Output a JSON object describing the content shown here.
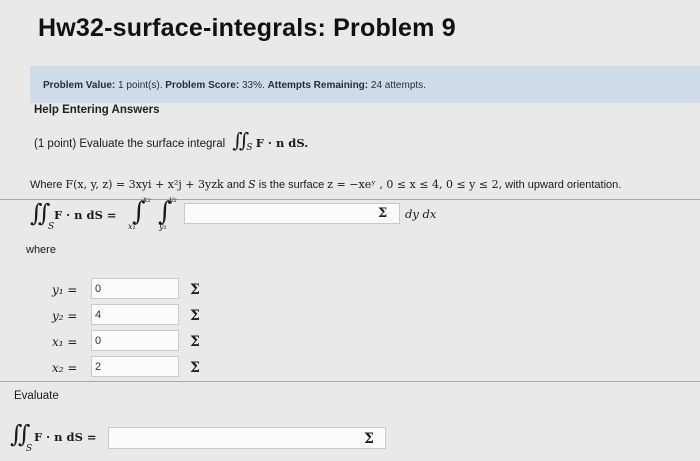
{
  "header": {
    "title": "Hw32-surface-integrals: Problem 9"
  },
  "status": {
    "value_label": "Problem Value:",
    "value_text": "1 point(s).",
    "score_label": "Problem Score:",
    "score_text": "33%.",
    "attempts_label": "Attempts Remaining:",
    "attempts_text": "24 attempts."
  },
  "help": {
    "link_text": "Help Entering Answers"
  },
  "problem": {
    "points": "(1 point)",
    "prompt": "Evaluate the surface integral",
    "integrand": "F · n dS.",
    "where_prefix": "Where",
    "field": "F(x, y, z) = 3xyi + x²j + 3yzk",
    "and_text": "and",
    "S": "S",
    "is_surface": "is the surface",
    "surface": "z = −xeʸ , 0 ≤ x ≤ 4,  0 ≤ y ≤ 2,",
    "orientation": "with upward orientation."
  },
  "setup": {
    "lhs": "F · n dS =",
    "upper_outer": "x₂",
    "lower_outer": "x₁",
    "upper_inner": "y₂",
    "lower_inner": "y₁",
    "differentials": "dy dx",
    "answer_value": ""
  },
  "where_label": "where",
  "bounds": [
    {
      "var": "y₁ =",
      "value": "0"
    },
    {
      "var": "y₂ =",
      "value": "4"
    },
    {
      "var": "x₁ =",
      "value": "0"
    },
    {
      "var": "x₂ =",
      "value": "2"
    }
  ],
  "evaluate": {
    "label": "Evaluate",
    "lhs": "F · n dS =",
    "answer_value": ""
  },
  "icons": {
    "sigma": "Σ"
  }
}
